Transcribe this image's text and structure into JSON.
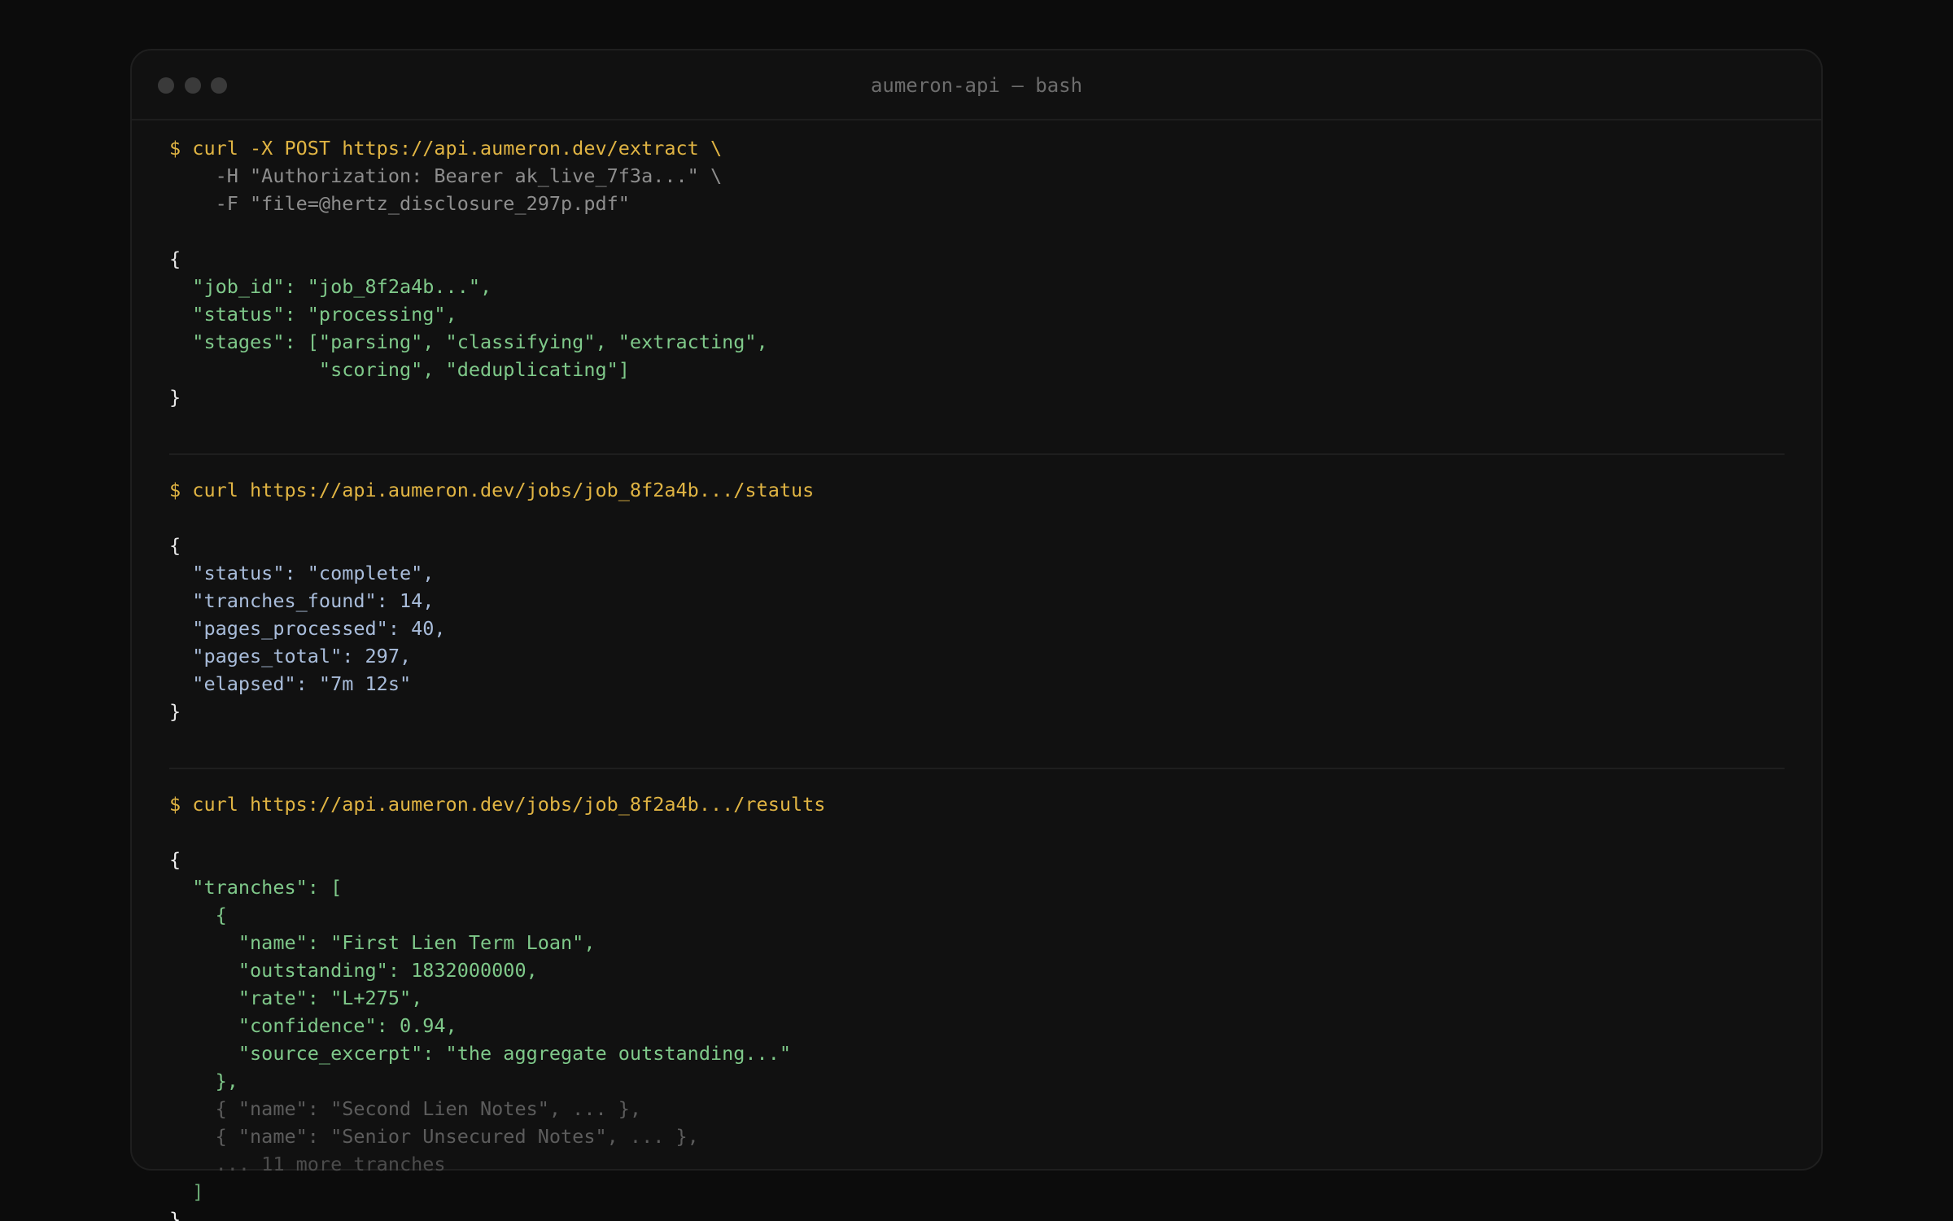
{
  "window": {
    "title": "aumeron-api — bash"
  },
  "block1": {
    "cmd": [
      "$ curl -X POST https://api.aumeron.dev/extract \\",
      "    -H \"Authorization: Bearer ak_live_7f3a...\" \\",
      "    -F \"file=@hertz_disclosure_297p.pdf\""
    ],
    "out": [
      "{",
      "  \"job_id\": \"job_8f2a4b...\",",
      "  \"status\": \"processing\",",
      "  \"stages\": [\"parsing\", \"classifying\", \"extracting\",",
      "             \"scoring\", \"deduplicating\"]",
      "}"
    ]
  },
  "block2": {
    "cmd": "$ curl https://api.aumeron.dev/jobs/job_8f2a4b.../status",
    "out": [
      "{",
      "  \"status\": \"complete\",",
      "  \"tranches_found\": 14,",
      "  \"pages_processed\": 40,",
      "  \"pages_total\": 297,",
      "  \"elapsed\": \"7m 12s\"",
      "}"
    ]
  },
  "block3": {
    "cmd": "$ curl https://api.aumeron.dev/jobs/job_8f2a4b.../results",
    "out": [
      "{",
      "  \"tranches\": [",
      "    {",
      "      \"name\": \"First Lien Term Loan\",",
      "      \"outstanding\": 1832000000,",
      "      \"rate\": \"L+275\",",
      "      \"confidence\": 0.94,",
      "      \"source_excerpt\": \"the aggregate outstanding...\"",
      "    },",
      "    { \"name\": \"Second Lien Notes\", ... },",
      "    { \"name\": \"Senior Unsecured Notes\", ... },",
      "    ... 11 more tranches",
      "  ]",
      "}"
    ]
  }
}
